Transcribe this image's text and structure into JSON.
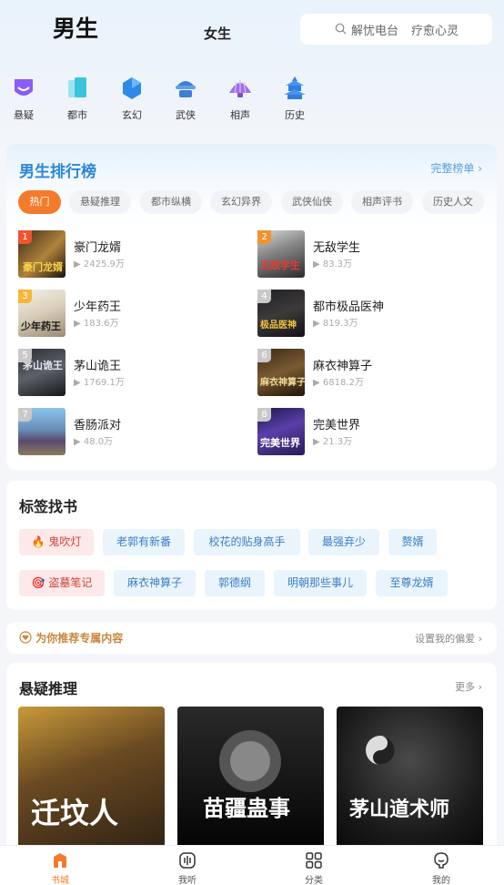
{
  "header": {
    "tab_male": "男生",
    "tab_female": "女生",
    "search_hint_1": "解忧电台",
    "search_hint_2": "疗愈心灵"
  },
  "categories": [
    {
      "label": "悬疑",
      "icon": "ghost-badge-icon"
    },
    {
      "label": "都市",
      "icon": "building-icon"
    },
    {
      "label": "玄幻",
      "icon": "hexagon-gem-icon"
    },
    {
      "label": "武侠",
      "icon": "swordsman-hat-icon"
    },
    {
      "label": "相声",
      "icon": "fan-icon"
    },
    {
      "label": "历史",
      "icon": "pagoda-icon"
    }
  ],
  "ranking": {
    "title": "男生排行榜",
    "more": "完整榜单",
    "chips": [
      "热门",
      "悬疑推理",
      "都市纵横",
      "玄幻异界",
      "武侠仙侠",
      "相声评书",
      "历史人文"
    ],
    "books": [
      {
        "rank": "1",
        "title": "豪门龙婿",
        "count": "2425.9万"
      },
      {
        "rank": "2",
        "title": "无敌学生",
        "count": "83.3万"
      },
      {
        "rank": "3",
        "title": "少年药王",
        "count": "183.6万"
      },
      {
        "rank": "4",
        "title": "都市极品医神",
        "count": "819.3万"
      },
      {
        "rank": "5",
        "title": "茅山诡王",
        "count": "1769.1万"
      },
      {
        "rank": "6",
        "title": "麻衣神算子",
        "count": "6818.2万"
      },
      {
        "rank": "7",
        "title": "香肠派对",
        "count": "48.0万"
      },
      {
        "rank": "8",
        "title": "完美世界",
        "count": "21.3万"
      }
    ]
  },
  "tags": {
    "title": "标签找书",
    "row1": [
      "鬼吹灯",
      "老郭有新番",
      "校花的贴身高手",
      "最强弃少",
      "赘婿"
    ],
    "row2": [
      "盗墓笔记",
      "麻衣神算子",
      "郭德纲",
      "明朝那些事儿",
      "至尊龙婿"
    ]
  },
  "preference": {
    "left": "为你推荐专属内容",
    "right": "设置我的偏爱"
  },
  "suspense": {
    "title": "悬疑推理",
    "more": "更多",
    "cover_texts": [
      "迁坟人",
      "苗疆蛊事",
      "茅山道术师"
    ]
  },
  "tabbar": [
    {
      "label": "书城",
      "icon": "bookstore-icon"
    },
    {
      "label": "我听",
      "icon": "listen-icon"
    },
    {
      "label": "分类",
      "icon": "category-grid-icon"
    },
    {
      "label": "我的",
      "icon": "profile-icon"
    }
  ],
  "colors": {
    "accent": "#f37b2b",
    "rank_title": "#2b86d8",
    "tag_blue": "#3a7fc4",
    "tag_hot": "#d0433c"
  }
}
